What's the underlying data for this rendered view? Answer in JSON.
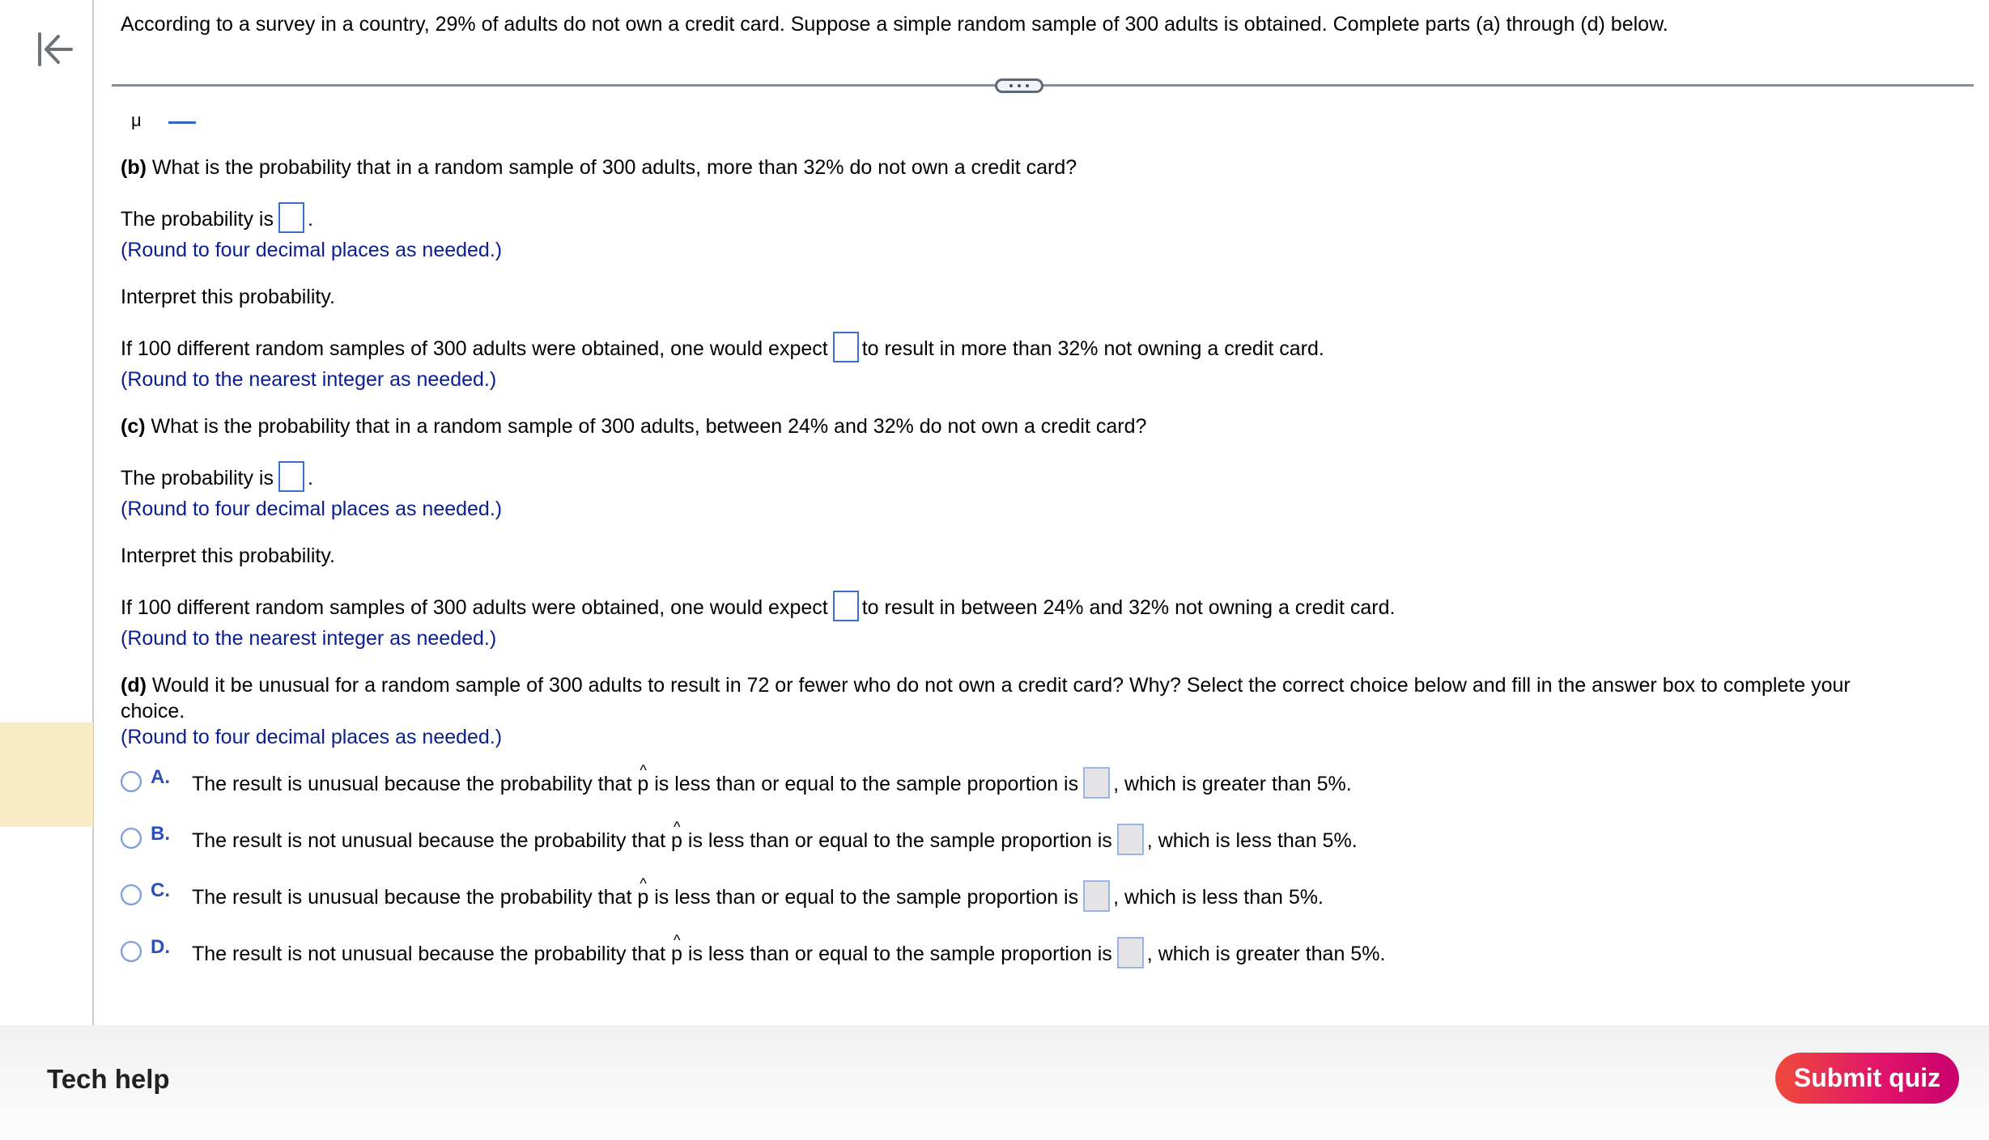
{
  "intro": "According to a survey in a country, 29% of adults do not own a credit card. Suppose a simple random sample of 300 adults is obtained. Complete parts (a) through (d) below.",
  "clipped_fragment": "μ",
  "part_b": {
    "label": "(b)",
    "question": " What is the probability that in a random sample of 300 adults, more than 32% do not own a credit card?",
    "prob_prefix": "The probability is",
    "prob_suffix": ".",
    "prob_value": "",
    "prob_hint": "(Round to four decimal places as needed.)",
    "interpret": "Interpret this probability.",
    "expect_prefix": "If 100 different random samples of 300 adults were obtained, one would expect",
    "expect_value": "",
    "expect_suffix": "to result in more than 32% not owning a credit card.",
    "expect_hint": "(Round to the nearest integer as needed.)"
  },
  "part_c": {
    "label": "(c)",
    "question": " What is the probability that in a random sample of 300 adults, between 24% and 32% do not own a credit card?",
    "prob_prefix": "The probability is",
    "prob_suffix": ".",
    "prob_value": "",
    "prob_hint": "(Round to four decimal places as needed.)",
    "interpret": "Interpret this probability.",
    "expect_prefix": "If 100 different random samples of 300 adults were obtained, one would expect",
    "expect_value": "",
    "expect_suffix": "to result in between 24% and 32% not owning a credit card.",
    "expect_hint": "(Round to the nearest integer as needed.)"
  },
  "part_d": {
    "label": "(d)",
    "question_line1": " Would it be unusual for a random sample of 300 adults to result in 72 or fewer who do not own a credit card? Why? Select the correct choice below and fill in the answer box to complete your",
    "question_line2": "choice.",
    "hint": "(Round to four decimal places as needed.)",
    "options": [
      {
        "letter": "A.",
        "pre": "The result is unusual because the probability that ",
        "var": "p",
        "mid": " is less than or equal to the sample proportion is",
        "post": ", which is greater than 5%.",
        "selected": false
      },
      {
        "letter": "B.",
        "pre": "The result is not unusual because the probability that ",
        "var": "p",
        "mid": " is less than or equal to the sample proportion is",
        "post": ", which is less than 5%.",
        "selected": false
      },
      {
        "letter": "C.",
        "pre": "The result is unusual because the probability that ",
        "var": "p",
        "mid": " is less than or equal to the sample proportion is",
        "post": ", which is less than 5%.",
        "selected": false
      },
      {
        "letter": "D.",
        "pre": "The result is not unusual because the probability that ",
        "var": "p",
        "mid": " is less than or equal to the sample proportion is",
        "post": ", which is greater than 5%.",
        "selected": false
      }
    ]
  },
  "footer": {
    "tech_help": "Tech help",
    "submit": "Submit quiz"
  },
  "colors": {
    "hint_text": "#0a1f8f",
    "answer_box_border": "#3a6fce",
    "option_letter": "#2a4fbf",
    "highlight": "#f9ebc3",
    "submit_gradient_start": "#ee4a3a",
    "submit_gradient_end": "#c8006d"
  }
}
